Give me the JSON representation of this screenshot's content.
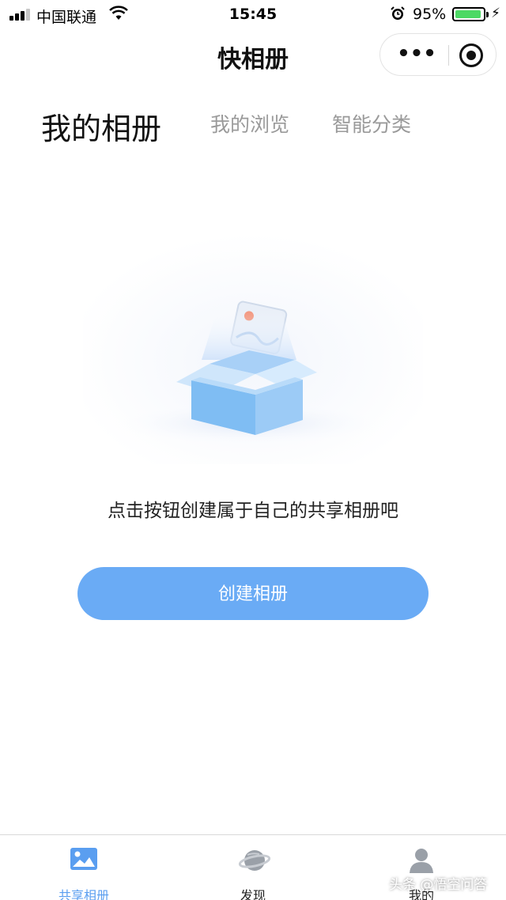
{
  "status_bar": {
    "carrier": "中国联通",
    "time": "15:45",
    "battery_percent": "95%",
    "battery_level": 0.95
  },
  "nav": {
    "title": "快相册",
    "more_icon": "more-dots-icon",
    "close_icon": "target-circle-icon"
  },
  "tabs": [
    {
      "label": "我的相册",
      "active": true
    },
    {
      "label": "我的浏览",
      "active": false
    },
    {
      "label": "智能分类",
      "active": false
    }
  ],
  "empty_state": {
    "illustration": "open-box-with-photo-icon",
    "message": "点击按钮创建属于自己的共享相册吧",
    "button_label": "创建相册"
  },
  "tabbar": [
    {
      "label": "共享相册",
      "icon": "image-icon",
      "active": true
    },
    {
      "label": "发现",
      "icon": "planet-icon",
      "active": false
    },
    {
      "label": "我的",
      "icon": "person-icon",
      "active": false
    }
  ],
  "watermark": "头条 @悟空问答",
  "colors": {
    "accent": "#6aabf5",
    "active_tab_icon": "#5a9ef0",
    "inactive_text": "#9a9a9a",
    "battery": "#4cd964"
  }
}
